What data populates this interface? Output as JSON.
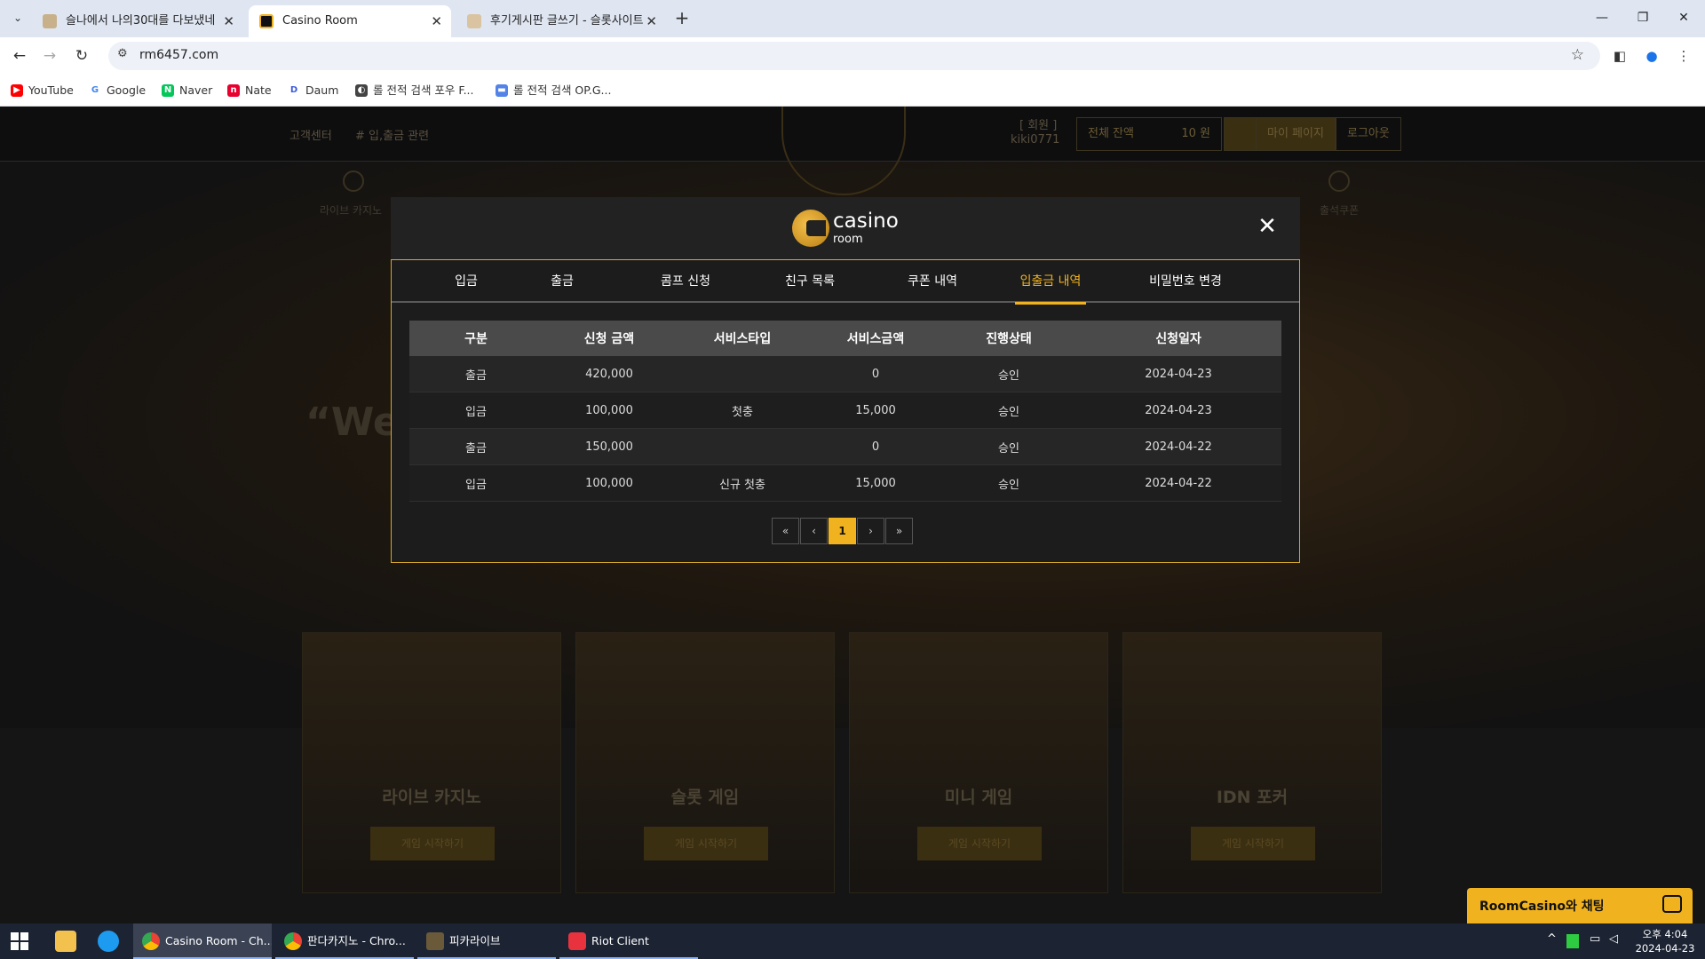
{
  "browser": {
    "tabs": [
      {
        "title": "슬나에서 나의30대를 다보냈네",
        "close": "✕"
      },
      {
        "title": "Casino Room",
        "close": "✕"
      },
      {
        "title": "후기게시판 글쓰기 - 슬롯사이트",
        "close": "✕"
      }
    ],
    "new_tab": "+",
    "url": "rm6457.com",
    "bookmarks": [
      {
        "label": "YouTube",
        "icon": "youtube-icon",
        "color": "#ff0000"
      },
      {
        "label": "Google",
        "icon": "google-icon",
        "color": "#4285f4"
      },
      {
        "label": "Naver",
        "icon": "naver-icon",
        "color": "#03c75a"
      },
      {
        "label": "Nate",
        "icon": "nate-icon",
        "color": "#e8002e"
      },
      {
        "label": "Daum",
        "icon": "daum-icon",
        "color": "#3b5bdb"
      },
      {
        "label": "롤 전적 검색 포우 F...",
        "icon": "fow-icon",
        "color": "#444444"
      },
      {
        "label": "롤 전적 검색 OP.G...",
        "icon": "opgg-icon",
        "color": "#5383e8"
      }
    ]
  },
  "site": {
    "header": {
      "breadcrumb_left": "고객센터",
      "breadcrumb_active": "# 입,출금 관련",
      "user_level": "[ 회원 ]",
      "user_id": "kiki0771",
      "balance_label": "전체 잔액",
      "balance_value": "10 원",
      "mypage": "마이 페이지",
      "logout": "로그아웃"
    },
    "nav": [
      "라이브 카지노",
      "출석쿠폰"
    ],
    "welcome": "“Wel",
    "games": [
      {
        "title": "라이브 카지노",
        "button": "게임 시작하기"
      },
      {
        "title": "슬롯 게임",
        "button": "게임 시작하기"
      },
      {
        "title": "미니 게임",
        "button": "게임 시작하기"
      },
      {
        "title": "IDN 포커",
        "button": "게임 시작하기"
      }
    ]
  },
  "modal": {
    "logo_text": "casino",
    "logo_sub": "room",
    "close": "✕",
    "tabs": [
      "입금",
      "출금",
      "콤프 신청",
      "친구 목록",
      "쿠폰 내역",
      "입출금 내역",
      "비밀번호 변경"
    ],
    "active_tab": "입출금 내역",
    "table": {
      "headers": [
        "구분",
        "신청 금액",
        "서비스타입",
        "서비스금액",
        "진행상태",
        "신청일자"
      ],
      "rows": [
        [
          "출금",
          "420,000",
          "",
          "0",
          "승인",
          "2024-04-23"
        ],
        [
          "입금",
          "100,000",
          "첫충",
          "15,000",
          "승인",
          "2024-04-23"
        ],
        [
          "출금",
          "150,000",
          "",
          "0",
          "승인",
          "2024-04-22"
        ],
        [
          "입금",
          "100,000",
          "신규 첫충",
          "15,000",
          "승인",
          "2024-04-22"
        ]
      ]
    },
    "pagination": {
      "first": "«",
      "prev": "‹",
      "current": "1",
      "next": "›",
      "last": "»"
    }
  },
  "chat": {
    "label": "RoomCasino와 채팅"
  },
  "taskbar": {
    "apps": [
      {
        "label": "Casino Room - Ch...",
        "icon": "chrome-icon"
      },
      {
        "label": "판다카지노 - Chro...",
        "icon": "chrome-icon"
      },
      {
        "label": "피카라이브",
        "icon": "pica-icon"
      },
      {
        "label": "Riot Client",
        "icon": "riot-icon"
      }
    ],
    "time": "오후 4:04",
    "date": "2024-04-23"
  },
  "colors": {
    "accent": "#f0b21e",
    "modal_bg": "#1c1c1c",
    "table_head": "#4a4a4a"
  }
}
